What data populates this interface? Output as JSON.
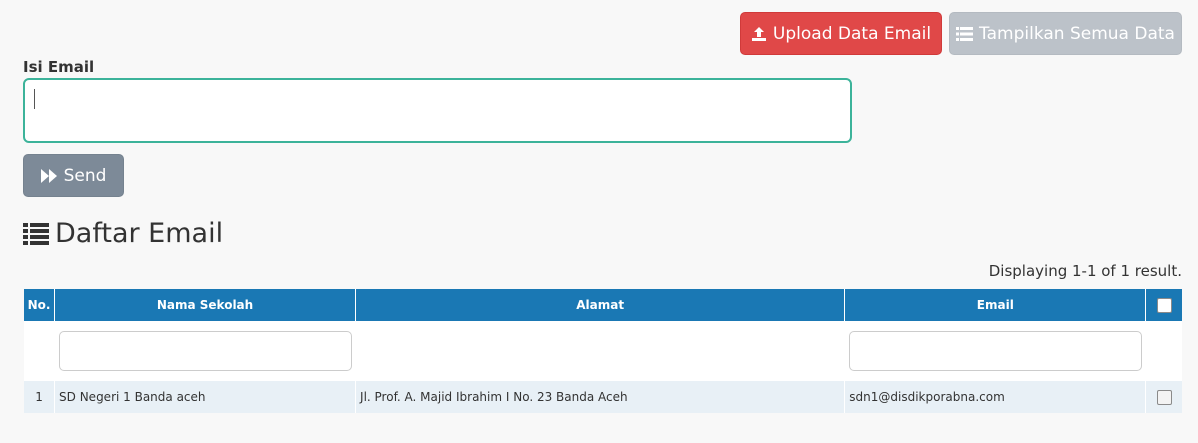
{
  "toolbar": {
    "upload_label": "Upload Data Email",
    "show_all_label": "Tampilkan Semua Data"
  },
  "form": {
    "label": "Isi Email",
    "value": "",
    "send_label": "Send"
  },
  "section": {
    "title": "Daftar Email"
  },
  "grid": {
    "summary": "Displaying 1-1 of 1 result.",
    "columns": [
      "No.",
      "Nama Sekolah",
      "Alamat",
      "Email"
    ],
    "rows": [
      {
        "no": "1",
        "nama_sekolah": "SD Negeri 1 Banda aceh",
        "alamat": "Jl. Prof. A. Majid Ibrahim I No. 23 Banda Aceh",
        "email": "sdn1@disdikporabna.com"
      }
    ]
  },
  "colors": {
    "upload_button": "#e04848",
    "show_all_button": "#bcc2c9",
    "send_button": "#7d8a98",
    "table_header": "#1a78b4",
    "textarea_border": "#3cb39a",
    "row_background": "#e8f0f6"
  },
  "icons": {
    "upload": "upload-icon",
    "list": "list-icon",
    "send": "fast-forward-icon"
  }
}
